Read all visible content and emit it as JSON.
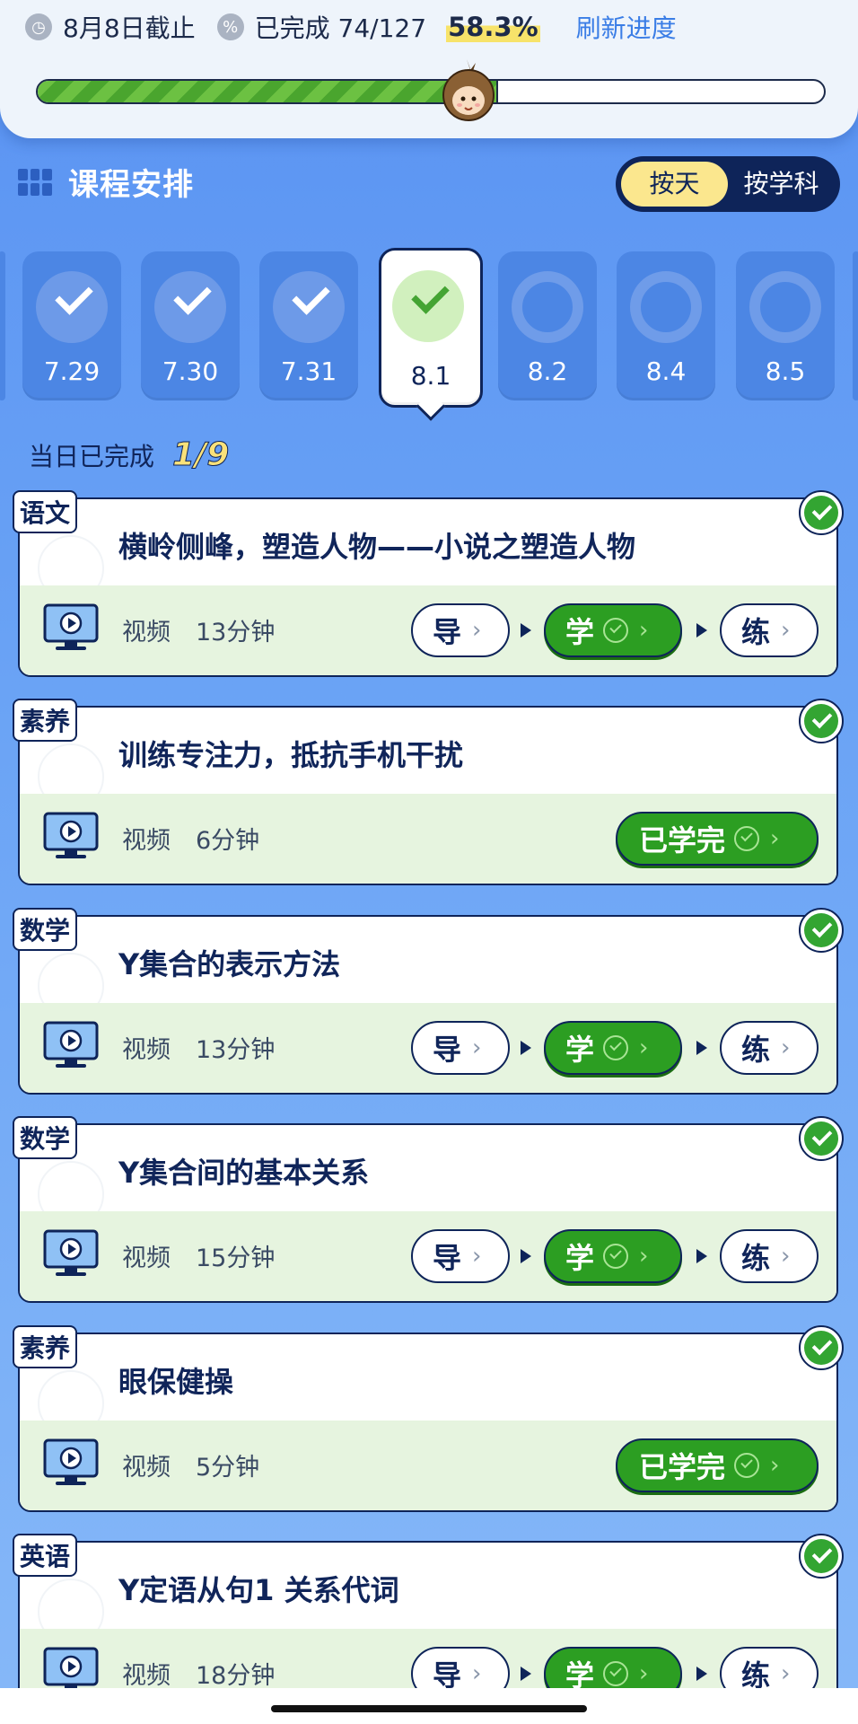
{
  "header": {
    "deadline": "8月8日截止",
    "completed": "已完成 74/127",
    "percent": "58.3%",
    "progress_fraction": 0.583,
    "refresh": "刷新进度"
  },
  "schedule": {
    "title": "课程安排",
    "toggle": [
      "按天",
      "按学科"
    ],
    "active_toggle": "按天"
  },
  "days": [
    {
      "label": "7.29",
      "status": "done"
    },
    {
      "label": "7.30",
      "status": "done"
    },
    {
      "label": "7.31",
      "status": "done"
    },
    {
      "label": "8.1",
      "status": "selected"
    },
    {
      "label": "8.2",
      "status": "todo"
    },
    {
      "label": "8.4",
      "status": "todo"
    },
    {
      "label": "8.5",
      "status": "todo"
    }
  ],
  "today": {
    "label": "当日已完成",
    "count": "1/9"
  },
  "lessons": [
    {
      "subject": "语文",
      "title": "横岭侧峰，塑造人物——小说之塑造人物",
      "type": "视频",
      "duration": "13分钟",
      "steps": [
        "导",
        "学",
        "练"
      ]
    },
    {
      "subject": "素养",
      "title": "训练专注力，抵抗手机干扰",
      "type": "视频",
      "duration": "6分钟",
      "done_label": "已学完"
    },
    {
      "subject": "数学",
      "title": "Y集合的表示方法",
      "type": "视频",
      "duration": "13分钟",
      "steps": [
        "导",
        "学",
        "练"
      ]
    },
    {
      "subject": "数学",
      "title": "Y集合间的基本关系",
      "type": "视频",
      "duration": "15分钟",
      "steps": [
        "导",
        "学",
        "练"
      ]
    },
    {
      "subject": "素养",
      "title": "眼保健操",
      "type": "视频",
      "duration": "5分钟",
      "done_label": "已学完"
    },
    {
      "subject": "英语",
      "title": "Y定语从句1 关系代词",
      "type": "视频",
      "duration": "18分钟",
      "steps": [
        "导",
        "学",
        "练"
      ]
    }
  ]
}
